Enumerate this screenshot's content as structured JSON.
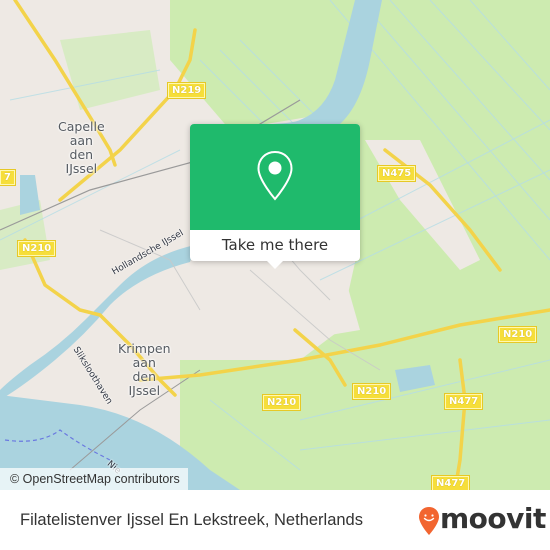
{
  "map": {
    "colors": {
      "land": "#eee9e4",
      "green": "#cdebb0",
      "meadow": "#c6eba0",
      "water": "#aad3df",
      "road_major": "#f6de3a",
      "road_minor": "#ffffff",
      "rail": "#9a9a9a",
      "popup_green": "#1fba6c",
      "brand_orange": "#f26530"
    },
    "places": [
      {
        "id": "capelle",
        "lines": [
          "Capelle",
          "aan",
          "den",
          "IJssel"
        ]
      },
      {
        "id": "krimpen",
        "lines": [
          "Krimpen",
          "aan",
          "den",
          "IJssel"
        ]
      }
    ],
    "roads": [
      {
        "id": "n219",
        "label": "N219"
      },
      {
        "id": "n475",
        "label": "N475"
      },
      {
        "id": "n210-west",
        "label": "N210"
      },
      {
        "id": "n210-center",
        "label": "N210"
      },
      {
        "id": "n210-mid",
        "label": "N210"
      },
      {
        "id": "n210-east",
        "label": "N210"
      },
      {
        "id": "n477-north",
        "label": "N477"
      },
      {
        "id": "n477-south",
        "label": "N477"
      },
      {
        "id": "n477-edge",
        "label": "7"
      }
    ],
    "waterways": [
      {
        "id": "hollandsche-ijssel",
        "label": "Hollandsche IJssel"
      },
      {
        "id": "sliksloothaven",
        "label": "Sliksloothaven"
      },
      {
        "id": "nieuwe-maas",
        "label": "Nie"
      }
    ],
    "marker_icon": "map-pin-icon"
  },
  "popup": {
    "button_label": "Take me there",
    "icon": "map-pin-icon"
  },
  "attribution": {
    "text": "© OpenStreetMap contributors"
  },
  "footer": {
    "title": "Filatelistenver Ijssel En Lekstreek, Netherlands",
    "brand": "moovit",
    "brand_icon": "moovit-logo-icon"
  }
}
